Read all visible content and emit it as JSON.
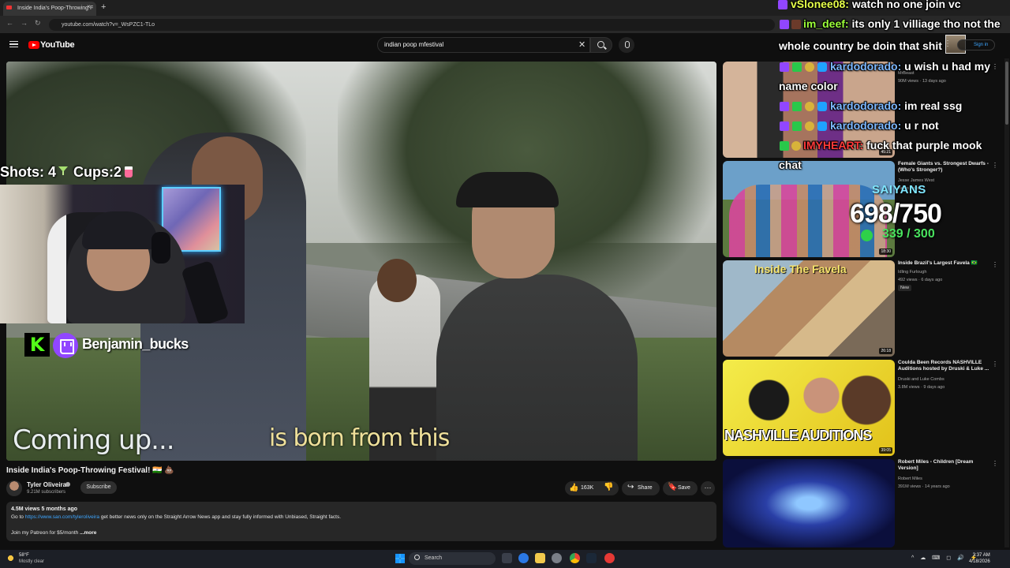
{
  "browser": {
    "tab_title": "Inside India's Poop-Throwing F",
    "tab_close": "×",
    "new_tab": "+",
    "url": "youtube.com/watch?v=_WsPZC1-TLo",
    "nav_back": "←",
    "nav_forward": "→",
    "nav_reload": "↻"
  },
  "header": {
    "logo_text": "YouTube",
    "search_value": "indian poop mfestival",
    "search_clear": "✕",
    "sign_in": "Sign in",
    "more": "⋮"
  },
  "player": {
    "caption_left": "Coming up...",
    "caption_right": "is born from this"
  },
  "overlay": {
    "shots_label": "Shots: 4",
    "cups_label": "Cups:2",
    "kick_letter": "K",
    "streamer_name": "Benjamin_bucks",
    "saiyans_label": "SAIYANS",
    "saiyans_count": "698/750",
    "online_count": "339 / 300"
  },
  "video": {
    "title": "Inside India's Poop-Throwing Festival! 🇮🇳 💩",
    "channel": "Tyler Oliveira",
    "subscribers": "9.21M subscribers",
    "subscribe_label": "Subscribe",
    "like_icon": "👍",
    "likes": "163K",
    "dislike_icon": "👎",
    "share_icon": "↪",
    "share_label": "Share",
    "save_icon": "🔖",
    "save_label": "Save",
    "more_actions": "···",
    "views_date": "4.5M views  5 months ago",
    "desc_prefix": "Go to ",
    "desc_link": "https://www.san.com/tyleroliveira",
    "desc_suffix": " get better news only on the Straight Arrow News app and stay fully informed with Unbiased, Straight facts.",
    "desc_line2": "Join my Patreon for $5/month  ",
    "desc_more": "...more"
  },
  "recommendations": [
    {
      "channel": "MrBeast",
      "meta": "90M views · 13 days ago",
      "duration": "45:21"
    },
    {
      "title": "Female Giants vs. Strongest Dwarfs - (Who's Stronger?)",
      "channel": "Jesse James West",
      "meta": "views · ago",
      "duration": "18:30"
    },
    {
      "title": "Inside Brazil's Largest Favela 🇧🇷",
      "channel": "Idling Furlough",
      "meta": "492 views · 6 days ago",
      "badge": "New",
      "thumb_text": "Inside The Favela",
      "duration": "26:18"
    },
    {
      "title": "Coulda Been Records NASHVILLE Auditions hosted by Druski & Luke ...",
      "channel": "Druski and Luke Combs",
      "meta": "3.8M views · 9 days ago",
      "thumb_text": "NASHVILLE AUDITIONS",
      "duration": "39:05"
    },
    {
      "title": "Robert Miles - Children [Dream Version]",
      "channel": "Robert Miles",
      "meta": "391M views · 14 years ago"
    }
  ],
  "chat": [
    {
      "user": "vSlonee08:",
      "message": " watch no one join vc"
    },
    {
      "user": "im_deef:",
      "message": " its only 1 villiage tho not the"
    },
    {
      "user": "",
      "message": "whole country be doin that shit"
    },
    {
      "user": "kardodorado:",
      "message": " u wish u had my"
    },
    {
      "user": "",
      "message": "name color"
    },
    {
      "user": "kardodorado:",
      "message": " im real ssg"
    },
    {
      "user": "kardodorado:",
      "message": " u r not"
    },
    {
      "user": "IMYHEART:",
      "message": " fuck that purple mook"
    },
    {
      "user": "",
      "message": "chat"
    }
  ],
  "taskbar": {
    "temperature": "58°F",
    "weather": "Mostly clear",
    "search": "Search",
    "time": "3:37 AM",
    "date": "4/18/2026",
    "tray": "^ ☁ ⌨ ◻ 🔊 ⚡"
  },
  "colors": {
    "youtube_red": "#ff0000",
    "twitch_purple": "#9146ff",
    "kick_green": "#53fc18",
    "link_blue": "#3ea6ff"
  }
}
